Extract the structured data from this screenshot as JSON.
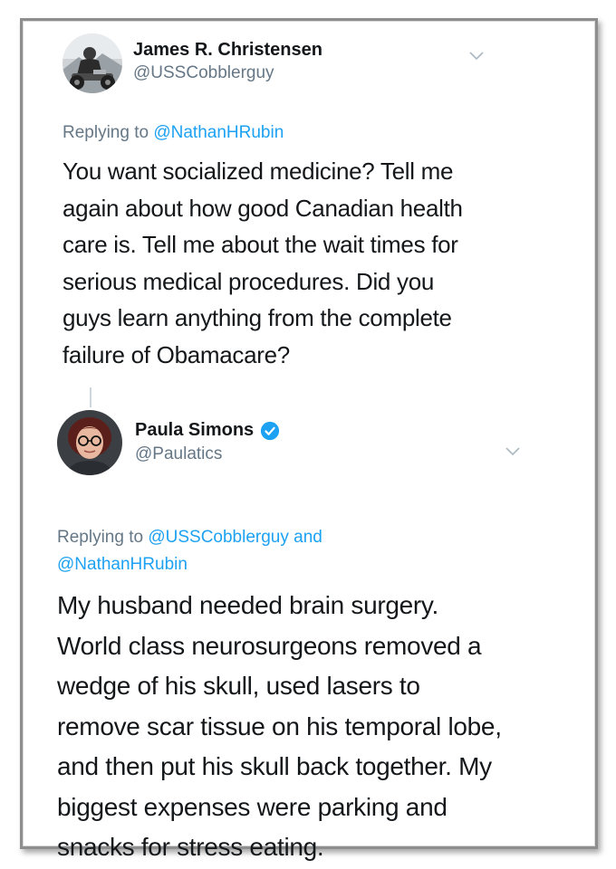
{
  "tweets": [
    {
      "display_name": "James R. Christensen",
      "handle": "@USSCobblerguy",
      "replying_prefix": "Replying to ",
      "replying_to": "@NathanHRubin",
      "body": "You want socialized medicine? Tell me\nagain about how good Canadian health\ncare is. Tell me about the wait times for\nserious medical procedures. Did you\nguys learn anything from the complete\nfailure of Obamacare?",
      "avatar_icon": "avatar-motorcycle-rider",
      "menu_icon": "chevron-down-icon"
    },
    {
      "display_name": "Paula Simons",
      "handle": "@Paulatics",
      "verified": true,
      "verified_icon": "verified-badge-icon",
      "replying_prefix": "Replying to ",
      "replying_to_1": "@USSCobblerguy",
      "replying_joiner": " and ",
      "replying_to_2": "@NathanHRubin",
      "body": "My husband needed brain surgery.\nWorld class neurosurgeons removed a\nwedge of his skull, used lasers to\nremove scar tissue on his temporal lobe,\nand then put his skull back together. My\nbiggest expenses were parking and\nsnacks for stress eating.",
      "avatar_icon": "avatar-woman-glasses",
      "menu_icon": "chevron-down-icon"
    }
  ],
  "colors": {
    "mention": "#1da1f2",
    "secondary_text": "#657786",
    "primary_text": "#14171a",
    "verified": "#1da1f2",
    "frame_border": "#8e8e8e",
    "thread_line": "#ccd6dd"
  }
}
